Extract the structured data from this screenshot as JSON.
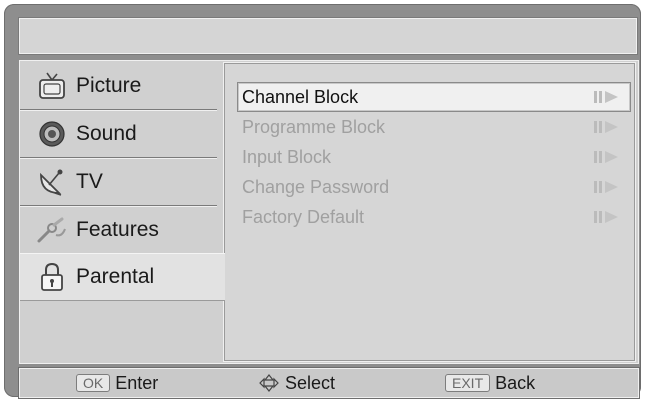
{
  "sidebar": {
    "items": [
      {
        "label": "Picture",
        "icon": "tv-icon"
      },
      {
        "label": "Sound",
        "icon": "speaker-icon"
      },
      {
        "label": "TV",
        "icon": "satellite-dish-icon"
      },
      {
        "label": "Features",
        "icon": "wrench-icon"
      },
      {
        "label": "Parental",
        "icon": "padlock-icon",
        "active": true
      }
    ]
  },
  "menu": {
    "items": [
      {
        "label": "Channel Block",
        "selected": true
      },
      {
        "label": "Programme Block"
      },
      {
        "label": "Input Block"
      },
      {
        "label": "Change Password"
      },
      {
        "label": "Factory Default"
      }
    ]
  },
  "footer": {
    "enter_key": "OK",
    "enter_label": "Enter",
    "select_label": "Select",
    "exit_key": "EXIT",
    "back_label": "Back"
  },
  "colors": {
    "frame": "#8e8e8e",
    "panel": "#d0d0d0",
    "selected_row": "#f0f0f0",
    "disabled_text": "#a0a0a0"
  }
}
